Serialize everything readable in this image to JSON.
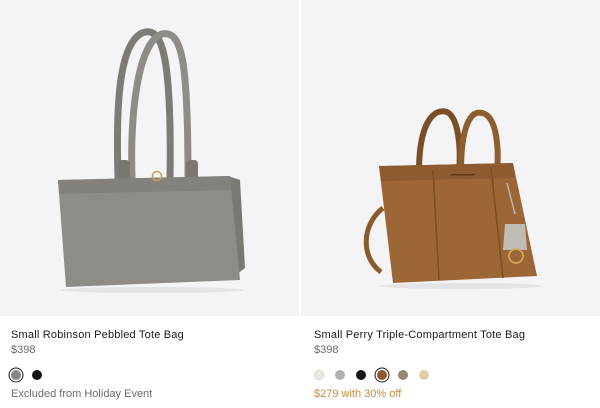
{
  "products": [
    {
      "name": "Small Robinson Pebbled Tote Bag",
      "price": "$398",
      "image_icon": "gray-tote-bag-image",
      "swatches": [
        {
          "color": "#8a8782",
          "selected": true
        },
        {
          "color": "#151515",
          "selected": false
        }
      ],
      "note": "Excluded from Holiday Event"
    },
    {
      "name": "Small Perry Triple-Compartment Tote Bag",
      "price": "$398",
      "image_icon": "tan-tote-bag-image",
      "swatches": [
        {
          "color": "#ece9e2",
          "selected": false
        },
        {
          "color": "#b0b0b2",
          "selected": false
        },
        {
          "color": "#151515",
          "selected": false
        },
        {
          "color": "#8a5a2c",
          "selected": true
        },
        {
          "color": "#9a8673",
          "selected": false
        },
        {
          "color": "#e3cba5",
          "selected": false
        }
      ],
      "note": "$279 with 30% off"
    }
  ],
  "colors": {
    "image_background": "#f4f4f6",
    "sale_text": "#c8893b"
  }
}
